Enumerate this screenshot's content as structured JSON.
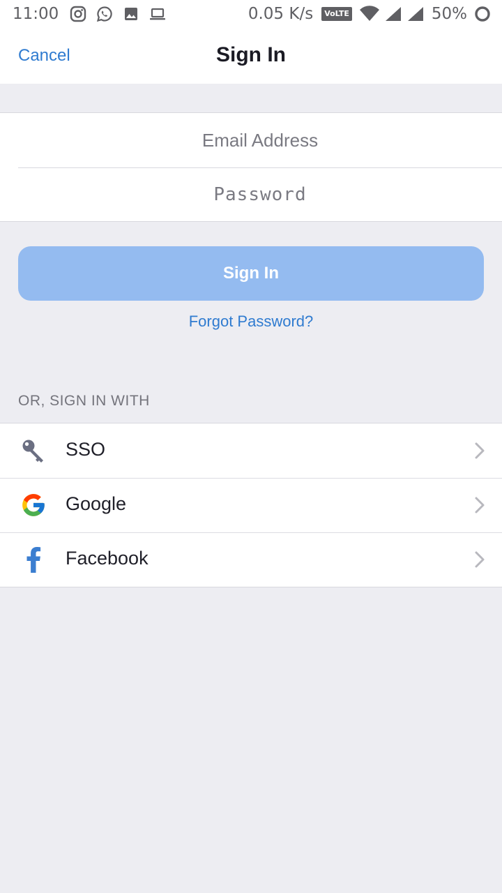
{
  "status_bar": {
    "time": "11:00",
    "speed": "0.05 K/s",
    "volte": "VoLTE",
    "battery": "50%",
    "icons": [
      "instagram-icon",
      "whatsapp-icon",
      "gallery-icon",
      "laptop-icon",
      "wifi-icon",
      "signal-icon",
      "signal-icon",
      "battery-ring-icon"
    ]
  },
  "nav": {
    "cancel_label": "Cancel",
    "title": "Sign In"
  },
  "form": {
    "email_placeholder": "Email Address",
    "password_placeholder": "Password"
  },
  "actions": {
    "signin_label": "Sign In",
    "forgot_label": "Forgot Password?"
  },
  "alt_signin": {
    "section_label": "OR, SIGN IN WITH",
    "providers": [
      {
        "label": "SSO",
        "icon": "key-icon"
      },
      {
        "label": "Google",
        "icon": "google-logo-icon"
      },
      {
        "label": "Facebook",
        "icon": "facebook-logo-icon"
      }
    ]
  },
  "colors": {
    "accent": "#2f7bd0",
    "button_disabled": "#94bbf0",
    "background": "#ededf2"
  }
}
